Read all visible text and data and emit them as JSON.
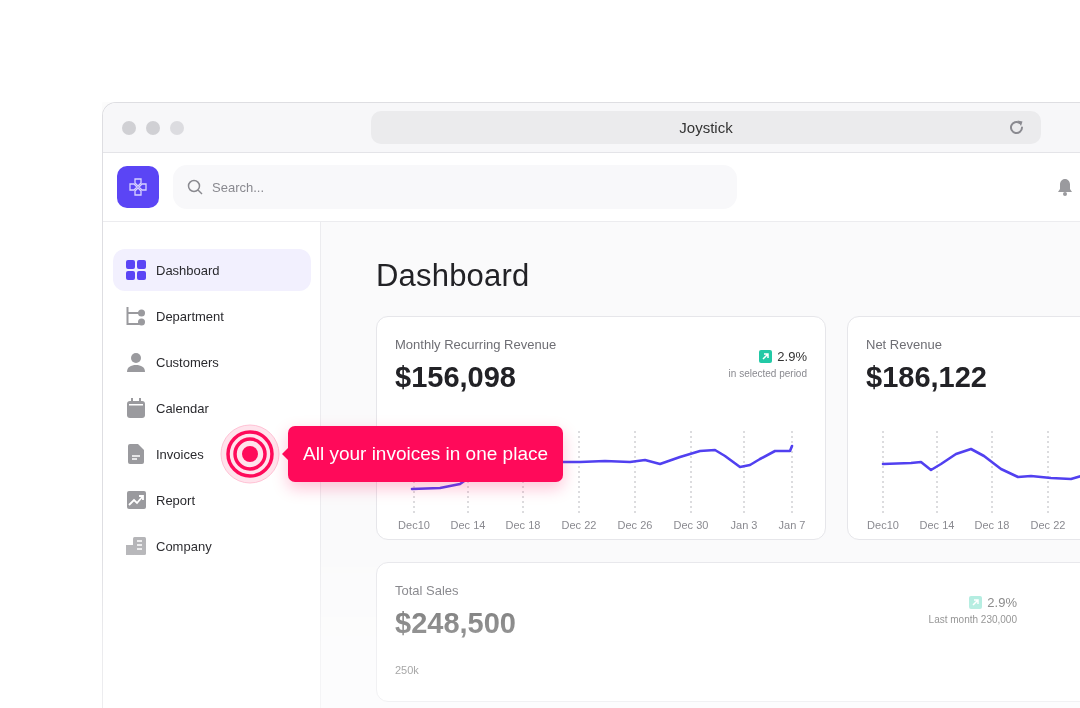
{
  "window": {
    "title": "Joystick"
  },
  "header": {
    "search": {
      "placeholder": "Search..."
    }
  },
  "sidebar": {
    "items": [
      {
        "label": "Dashboard",
        "selected": true
      },
      {
        "label": "Department",
        "selected": false
      },
      {
        "label": "Customers",
        "selected": false
      },
      {
        "label": "Calendar",
        "selected": false
      },
      {
        "label": "Invoices",
        "selected": false
      },
      {
        "label": "Report",
        "selected": false
      },
      {
        "label": "Company",
        "selected": false
      }
    ]
  },
  "page_title": "Dashboard",
  "cards": [
    {
      "title": "Monthly Recurring Revenue",
      "value": "$156,098",
      "change": "2.9%",
      "change_note": "in selected period",
      "x_labels": [
        "Dec10",
        "Dec 14",
        "Dec 18",
        "Dec 22",
        "Dec 26",
        "Dec 30",
        "Jan 3",
        "Jan 7"
      ]
    },
    {
      "title": "Net Revenue",
      "value": "$186,122",
      "x_labels": [
        "Dec10",
        "Dec 14",
        "Dec 18",
        "Dec 22"
      ]
    }
  ],
  "total_sales": {
    "title": "Total Sales",
    "value": "$248,500",
    "change": "2.9%",
    "change_note": "Last month 230,000",
    "y_label": "250k"
  },
  "tooltip": {
    "text": "All your invoices in one place"
  }
}
